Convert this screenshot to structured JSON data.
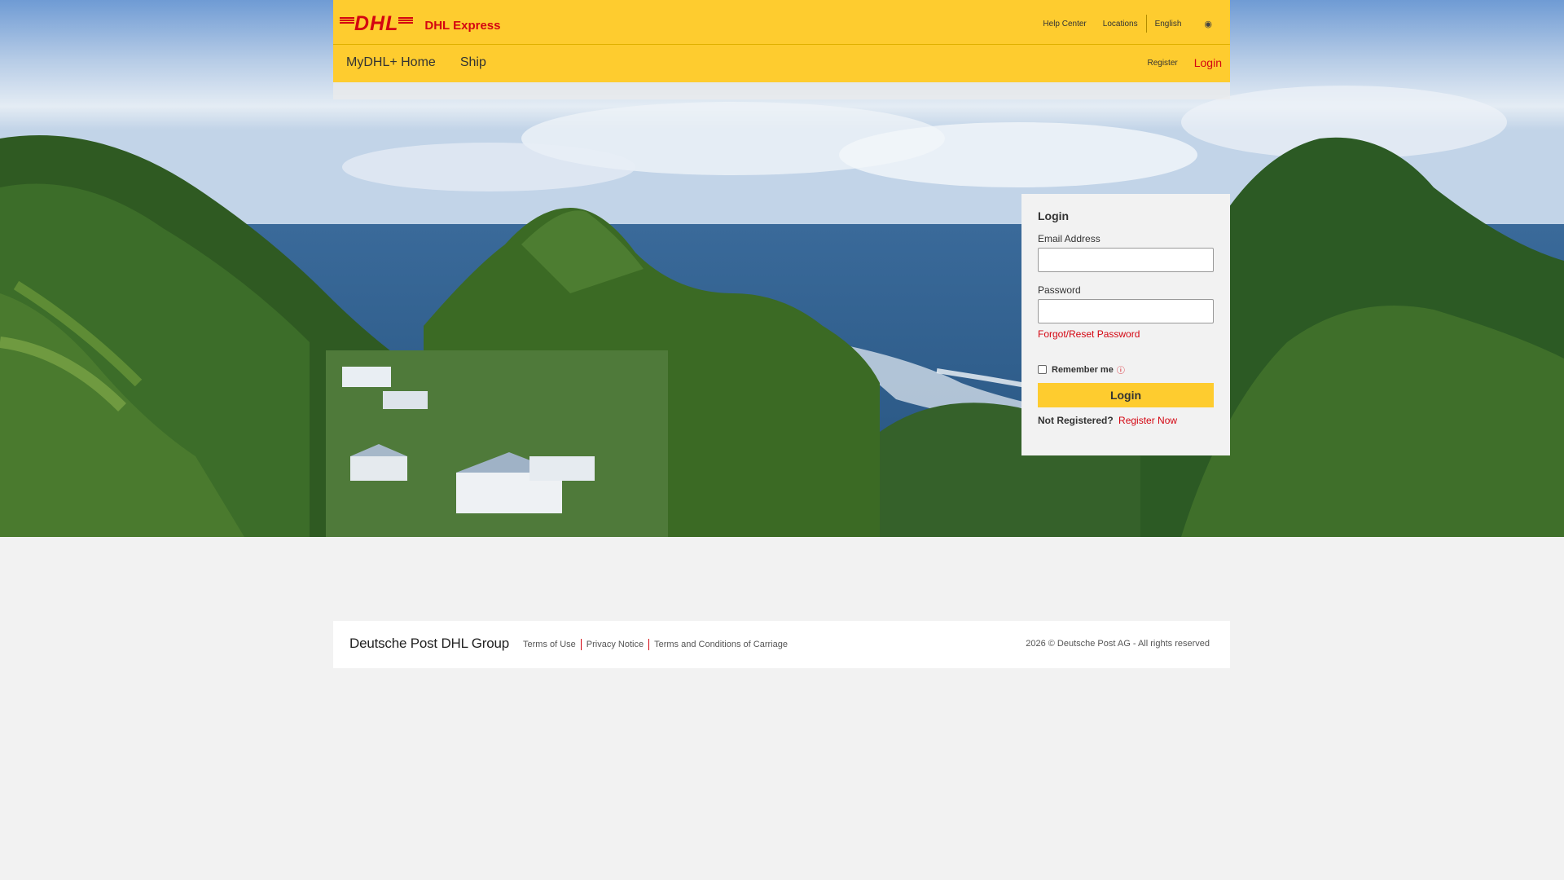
{
  "header": {
    "logo_mark": "DHL",
    "product": "DHL Express",
    "top_links": {
      "help": "Help Center",
      "locations": "Locations",
      "language": "English",
      "globe_icon": "globe-icon"
    },
    "nav": {
      "home": "MyDHL+ Home",
      "ship": "Ship",
      "register": "Register",
      "login": "Login"
    }
  },
  "login": {
    "title": "Login",
    "email_label": "Email Address",
    "email_value": "",
    "password_label": "Password",
    "password_value": "",
    "forgot": "Forgot/Reset Password",
    "remember": "Remember me",
    "remember_checked": false,
    "info_icon": "info-icon",
    "button": "Login",
    "not_registered": "Not Registered?",
    "register_now": "Register Now"
  },
  "footer": {
    "brand": "Deutsche Post DHL Group",
    "links": [
      "Terms of Use",
      "Privacy Notice",
      "Terms and Conditions of Carriage"
    ],
    "copyright": "2026 © Deutsche Post AG - All rights reserved"
  },
  "colors": {
    "brand_yellow": "#fecc2f",
    "brand_red": "#d40511",
    "page_bg": "#f2f2f2"
  }
}
